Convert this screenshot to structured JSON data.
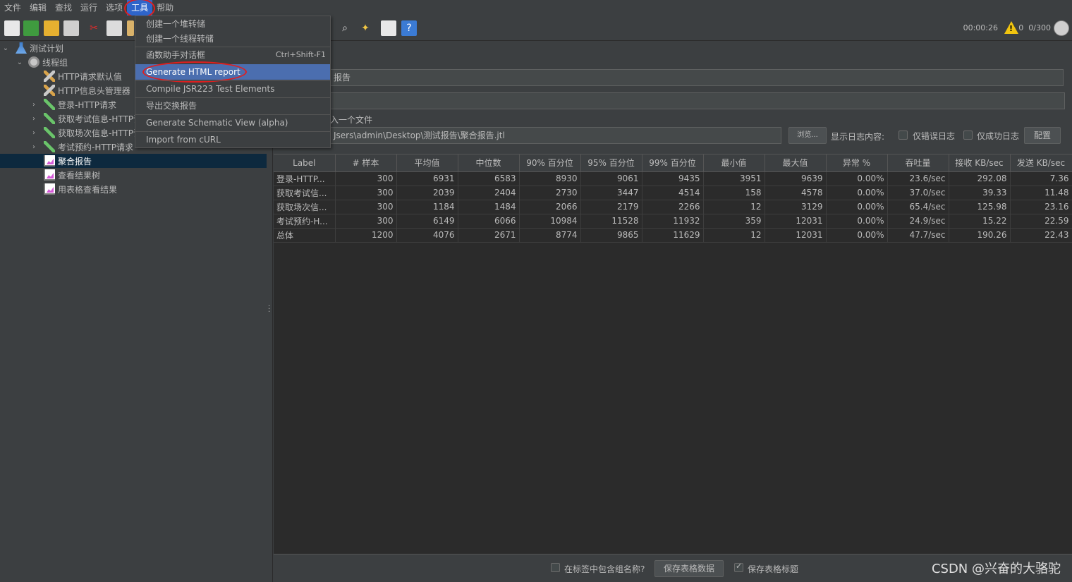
{
  "menubar": {
    "items": [
      "文件",
      "编辑",
      "查找",
      "运行",
      "选项",
      "工具",
      "帮助"
    ],
    "active_index": 5
  },
  "toolbar": {
    "elapsed_time": "00:00:26",
    "warning_count": "0",
    "threads": "0/300"
  },
  "tree": {
    "items": [
      {
        "label": "测试计划",
        "icon": "flask-icon"
      },
      {
        "label": "线程组",
        "icon": "gear-icon"
      },
      {
        "label": "HTTP请求默认值",
        "icon": "tools-icon"
      },
      {
        "label": "HTTP信息头管理器",
        "icon": "tools-icon"
      },
      {
        "label": "登录-HTTP请求",
        "icon": "pipette-icon"
      },
      {
        "label": "获取考试信息-HTTP请",
        "icon": "pipette-icon"
      },
      {
        "label": "获取场次信息-HTTP请",
        "icon": "pipette-icon"
      },
      {
        "label": "考试预约-HTTP请求",
        "icon": "pipette-icon"
      },
      {
        "label": "聚合报告",
        "icon": "chart-icon"
      },
      {
        "label": "查看结果树",
        "icon": "chart-icon"
      },
      {
        "label": "用表格查看结果",
        "icon": "chart-icon"
      }
    ],
    "selected_index": 8
  },
  "dropdown": {
    "items": [
      {
        "label": "创建一个堆转储",
        "shortcut": ""
      },
      {
        "label": "创建一个线程转储",
        "shortcut": ""
      },
      {
        "label": "函数助手对话框",
        "shortcut": "Ctrl+Shift-F1"
      },
      {
        "label": "Generate HTML report",
        "shortcut": ""
      },
      {
        "label": "Compile JSR223 Test Elements",
        "shortcut": ""
      },
      {
        "label": "导出交换报告",
        "shortcut": ""
      },
      {
        "label": "Generate Schematic View (alpha)",
        "shortcut": ""
      },
      {
        "label": "Import from cURL",
        "shortcut": ""
      }
    ],
    "highlighted_index": 3
  },
  "report": {
    "name_value": "报告",
    "comment_value": "",
    "file_label": "入一个文件",
    "file_path": "Jsers\\admin\\Desktop\\测试报告\\聚合报告.jtl",
    "browse_label": "浏览...",
    "log_label": "显示日志内容:",
    "errors_only_label": "仅错误日志",
    "success_only_label": "仅成功日志",
    "config_label": "配置"
  },
  "table": {
    "headers": [
      "Label",
      "# 样本",
      "平均值",
      "中位数",
      "90% 百分位",
      "95% 百分位",
      "99% 百分位",
      "最小值",
      "最大值",
      "异常 %",
      "吞吐量",
      "接收 KB/sec",
      "发送 KB/sec"
    ],
    "rows": [
      [
        "登录-HTTP...",
        "300",
        "6931",
        "6583",
        "8930",
        "9061",
        "9435",
        "3951",
        "9639",
        "0.00%",
        "23.6/sec",
        "292.08",
        "7.36"
      ],
      [
        "获取考试信...",
        "300",
        "2039",
        "2404",
        "2730",
        "3447",
        "4514",
        "158",
        "4578",
        "0.00%",
        "37.0/sec",
        "39.33",
        "11.48"
      ],
      [
        "获取场次信...",
        "300",
        "1184",
        "1484",
        "2066",
        "2179",
        "2266",
        "12",
        "3129",
        "0.00%",
        "65.4/sec",
        "125.98",
        "23.16"
      ],
      [
        "考试预约-H...",
        "300",
        "6149",
        "6066",
        "10984",
        "11528",
        "11932",
        "359",
        "12031",
        "0.00%",
        "24.9/sec",
        "15.22",
        "22.59"
      ],
      [
        "总体",
        "1200",
        "4076",
        "2671",
        "8774",
        "9865",
        "11629",
        "12",
        "12031",
        "0.00%",
        "47.7/sec",
        "190.26",
        "22.43"
      ]
    ]
  },
  "bottom": {
    "include_group_label": "在标签中包含组名称?",
    "save_data_label": "保存表格数据",
    "save_header_label": "保存表格标题"
  },
  "watermark": "CSDN @兴奋的大骆驼",
  "colors": {
    "menu_active": "#2f65ca",
    "dropdown_highlight": "#4b6eaf",
    "annotation_red": "#e01e1e",
    "tree_selected": "#0d293e"
  }
}
